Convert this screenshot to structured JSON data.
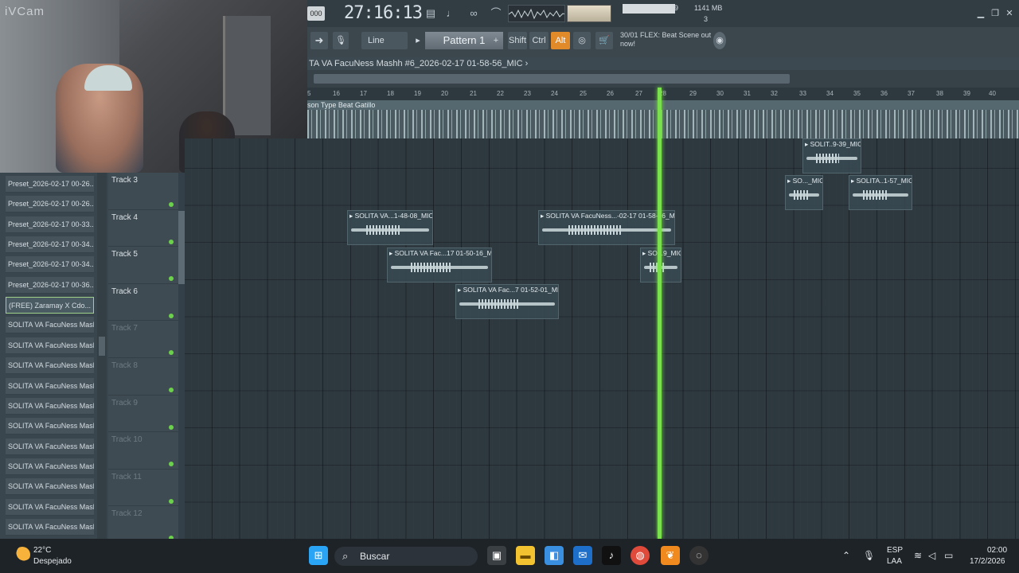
{
  "webcam": {
    "watermark": "iVCam"
  },
  "toolbar": {
    "tempo_label": "000",
    "time": "27:16:13",
    "cpu_value": "49",
    "memory": "1141 MB",
    "voices": "3",
    "snap_label": "Line",
    "pattern_label": "Pattern 1",
    "pattern_plus": "+",
    "shift_label": "Shift",
    "ctrl_label": "Ctrl",
    "alt_label": "Alt",
    "hint_counter": "30/01",
    "hint_text": "FLEX: Beat Scene out now!"
  },
  "playlist": {
    "title": "TA VA FacuNess Mashh #6_2026-02-17 01-58-56_MIC ›",
    "ruler": [
      "5",
      "16",
      "17",
      "18",
      "19",
      "20",
      "21",
      "22",
      "23",
      "24",
      "25",
      "26",
      "27",
      "28",
      "29",
      "30",
      "31",
      "32",
      "33",
      "34",
      "35",
      "36",
      "37",
      "38",
      "39",
      "40"
    ],
    "beat_track_label": "son Type Beat Gatillo",
    "tracks": [
      {
        "name": "Track 3",
        "active": true
      },
      {
        "name": "Track 4",
        "active": true
      },
      {
        "name": "Track 5",
        "active": true
      },
      {
        "name": "Track 6",
        "active": true
      },
      {
        "name": "Track 7",
        "active": false
      },
      {
        "name": "Track 8",
        "active": false
      },
      {
        "name": "Track 9",
        "active": false
      },
      {
        "name": "Track 10",
        "active": false
      },
      {
        "name": "Track 11",
        "active": false
      },
      {
        "name": "Track 12",
        "active": false
      }
    ],
    "clips": [
      {
        "label": "▸ SOLIT..9-39_MIC"
      },
      {
        "label": "▸ SO..._MIC"
      },
      {
        "label": "▸ SOLITA..1-57_MIC"
      },
      {
        "label": "▸ SOLITA VA...1-48-08_MIC"
      },
      {
        "label": "▸ SOLITA VA FacuNess...-02-17 01-58-56_MIC"
      },
      {
        "label": "▸ SOLITA VA Fac...17 01-50-16_MIC"
      },
      {
        "label": "▸ SO...9_MIC"
      },
      {
        "label": "▸ SOLITA VA Fac...7 01-52-01_MIC"
      }
    ]
  },
  "browser": {
    "items": [
      "Preset_2026-02-17 00-26...",
      "Preset_2026-02-17 00-26...",
      "Preset_2026-02-17 00-33...",
      "Preset_2026-02-17 00-34...",
      "Preset_2026-02-17 00-34...",
      "Preset_2026-02-17 00-36...",
      "(FREE) Zaramay X Cdo...",
      "SOLITA VA FacuNess Mash...",
      "SOLITA VA FacuNess Mash...",
      "SOLITA VA FacuNess Mash...",
      "SOLITA VA FacuNess Mash...",
      "SOLITA VA FacuNess Mash...",
      "SOLITA VA FacuNess Mash...",
      "SOLITA VA FacuNess Mash...",
      "SOLITA VA FacuNess Mash...",
      "SOLITA VA FacuNess Mash...",
      "SOLITA VA FacuNess Mash...",
      "SOLITA VA FacuNess Mash..."
    ],
    "selected_index": 6
  },
  "taskbar": {
    "temperature": "22°C",
    "weather": "Despejado",
    "search_placeholder": "Buscar",
    "lang_top": "ESP",
    "lang_bottom": "LAA",
    "clock_time": "02:00",
    "clock_date": "17/2/2026"
  },
  "colors": {
    "playhead": "#7be04d",
    "accent_alt": "#e08a2a",
    "led": "#6cd14a"
  }
}
